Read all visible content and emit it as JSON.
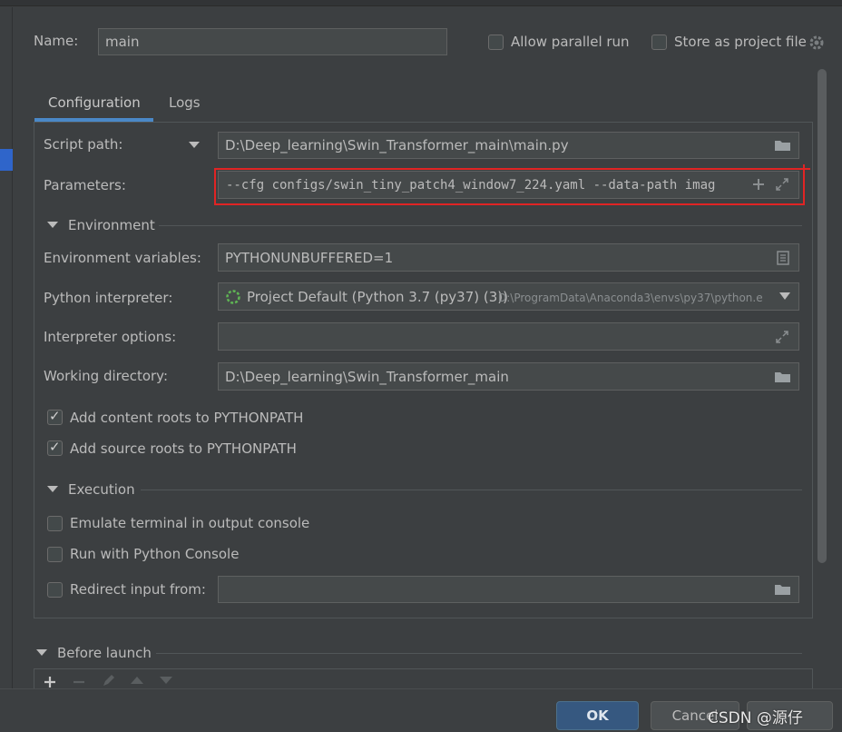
{
  "name": {
    "label": "Name:",
    "value": "main"
  },
  "options": {
    "allow_parallel": "Allow parallel run",
    "store_project_file": "Store as project file"
  },
  "tabs": [
    {
      "label": "Configuration",
      "active": true
    },
    {
      "label": "Logs",
      "active": false
    }
  ],
  "script_path": {
    "label": "Script path:",
    "value": "D:\\Deep_learning\\Swin_Transformer_main\\main.py"
  },
  "parameters": {
    "label": "Parameters:",
    "value": "--cfg configs/swin_tiny_patch4_window7_224.yaml --data-path imag"
  },
  "environment": {
    "section_label": "Environment",
    "env_vars_label": "Environment variables:",
    "env_vars_value": "PYTHONUNBUFFERED=1",
    "interpreter_label": "Python interpreter:",
    "interpreter_value": "Project Default (Python 3.7 (py37) (3))",
    "interpreter_path": "D:\\ProgramData\\Anaconda3\\envs\\py37\\python.e",
    "interp_options_label": "Interpreter options:",
    "interp_options_value": "",
    "working_dir_label": "Working directory:",
    "working_dir_value": "D:\\Deep_learning\\Swin_Transformer_main",
    "add_content_roots": "Add content roots to PYTHONPATH",
    "add_source_roots": "Add source roots to PYTHONPATH"
  },
  "execution": {
    "section_label": "Execution",
    "emulate_terminal": "Emulate terminal in output console",
    "run_python_console": "Run with Python Console",
    "redirect_input": "Redirect input from:",
    "redirect_value": ""
  },
  "before_launch": {
    "section_label": "Before launch"
  },
  "buttons": {
    "ok": "OK",
    "cancel": "Cancel"
  },
  "watermark": "CSDN @源仔",
  "colors": {
    "highlight": "#e02424",
    "accent": "#4a88c7",
    "ok_button": "#365880"
  },
  "icons": [
    "settings-gear-icon",
    "folder-icon",
    "plus-icon",
    "expand-icon",
    "document-icon",
    "chevron-down-icon",
    "spinner-icon"
  ]
}
